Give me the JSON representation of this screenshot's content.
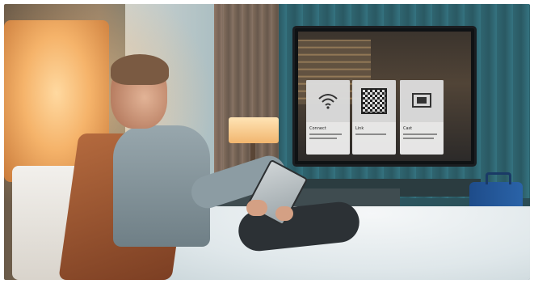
{
  "tv": {
    "cards": [
      {
        "icon": "wifi-icon",
        "title": "Connect",
        "subtitle": ""
      },
      {
        "icon": "qr-code-icon",
        "title": "Link",
        "subtitle": ""
      },
      {
        "icon": "cast-icon",
        "title": "Cast",
        "subtitle": ""
      }
    ]
  },
  "colors": {
    "warm_light": "#f5b36a",
    "teal_wall": "#2f5a64",
    "luggage_blue": "#2a63a8"
  }
}
